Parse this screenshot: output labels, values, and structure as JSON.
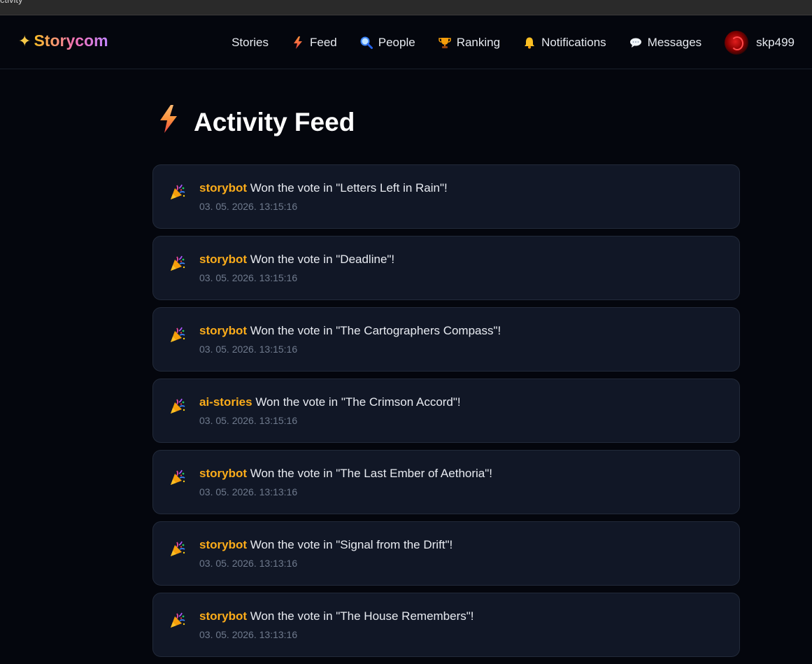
{
  "window": {
    "title": "ctivity"
  },
  "brand": {
    "icon": "sparkle-icon",
    "name": "Storycom"
  },
  "nav": {
    "items": [
      {
        "label": "Stories",
        "icon": ""
      },
      {
        "label": "Feed",
        "icon": "lightning-icon"
      },
      {
        "label": "People",
        "icon": "magnifier-icon"
      },
      {
        "label": "Ranking",
        "icon": "trophy-icon"
      },
      {
        "label": "Notifications",
        "icon": "bell-icon"
      },
      {
        "label": "Messages",
        "icon": "speech-bubble-icon"
      }
    ],
    "user": {
      "username": "skp499",
      "avatar": "avatar-rose"
    }
  },
  "page": {
    "title": "Activity Feed",
    "title_icon": "lightning-icon"
  },
  "feed": [
    {
      "user": "storybot",
      "text": " Won the vote in \"Letters Left in Rain\"!",
      "timestamp": "03. 05. 2026. 13:15:16",
      "icon": "party-popper-icon"
    },
    {
      "user": "storybot",
      "text": " Won the vote in \"Deadline\"!",
      "timestamp": "03. 05. 2026. 13:15:16",
      "icon": "party-popper-icon"
    },
    {
      "user": "storybot",
      "text": " Won the vote in \"The Cartographers Compass\"!",
      "timestamp": "03. 05. 2026. 13:15:16",
      "icon": "party-popper-icon"
    },
    {
      "user": "ai-stories",
      "text": " Won the vote in \"The Crimson Accord\"!",
      "timestamp": "03. 05. 2026. 13:15:16",
      "icon": "party-popper-icon"
    },
    {
      "user": "storybot",
      "text": " Won the vote in \"The Last Ember of Aethoria\"!",
      "timestamp": "03. 05. 2026. 13:13:16",
      "icon": "party-popper-icon"
    },
    {
      "user": "storybot",
      "text": " Won the vote in \"Signal from the Drift\"!",
      "timestamp": "03. 05. 2026. 13:13:16",
      "icon": "party-popper-icon"
    },
    {
      "user": "storybot",
      "text": " Won the vote in \"The House Remembers\"!",
      "timestamp": "03. 05. 2026. 13:13:16",
      "icon": "party-popper-icon"
    }
  ],
  "colors": {
    "background": "#04060d",
    "card": "#111726",
    "username": "#fbac1a",
    "timestamp": "#6f7a8d",
    "accent": "#f97316"
  }
}
